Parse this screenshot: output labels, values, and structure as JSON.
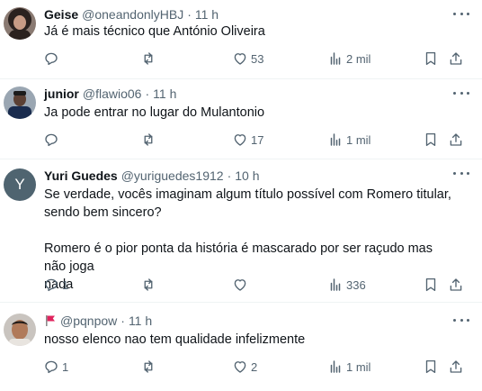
{
  "posts": [
    {
      "name": "Geise",
      "handle": "@oneandonlyHBJ",
      "separator": "·",
      "time": "11 h",
      "text_lines": [
        "Já é mais técnico que António Oliveira"
      ],
      "replies": "",
      "reposts": "",
      "likes": "53",
      "views": "2 mil",
      "avatar_icon": "profile-photo-woman"
    },
    {
      "name": "junior",
      "handle": "@flawio06",
      "separator": "·",
      "time": "11 h",
      "text_lines": [
        "Ja pode entrar no lugar do Mulantonio"
      ],
      "replies": "",
      "reposts": "",
      "likes": "17",
      "views": "1 mil",
      "avatar_icon": "profile-photo-player"
    },
    {
      "name": "Yuri Guedes",
      "handle": "@yuriguedes1912",
      "separator": "·",
      "time": "10 h",
      "text_lines": [
        "Se verdade, vocês imaginam algum título possível com Romero titular,",
        "sendo bem sincero?",
        "Romero é o pior ponta da história é mascarado por ser raçudo mas não joga",
        "nada"
      ],
      "replies": "1",
      "reposts": "",
      "likes": "",
      "views": "336",
      "avatar_letter": "Y"
    },
    {
      "name": "",
      "handle": "@pqnpow",
      "separator": "·",
      "time": "11 h",
      "text_lines": [
        "nosso elenco nao tem qualidade infelizmente"
      ],
      "replies": "1",
      "reposts": "",
      "likes": "2",
      "views": "1 mil",
      "avatar_icon": "profile-photo-boy",
      "badge_icon": "red-flag-icon"
    }
  ],
  "colors": {
    "text": "#0f1419",
    "secondary": "#536471",
    "divider": "#eff3f4",
    "flag": "#e0245e",
    "avatar_letter_bg": "#4f6470"
  }
}
